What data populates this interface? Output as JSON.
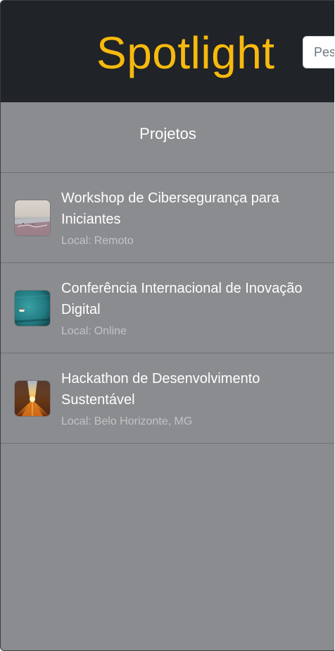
{
  "header": {
    "brand": "Spotlight",
    "search_placeholder": "Pesquisar"
  },
  "section": {
    "title": "Projetos"
  },
  "projects": [
    {
      "title": "Workshop de Cibersegurança para Iniciantes",
      "location_prefix": "Local:",
      "location": "Remoto",
      "thumbnail": "beach-photo"
    },
    {
      "title": "Conferência Internacional de Inovação Digital",
      "location_prefix": "Local:",
      "location": "Online",
      "thumbnail": "sea-boat-photo"
    },
    {
      "title": "Hackathon de Desenvolvimento Sustentável",
      "location_prefix": "Local:",
      "location": "Belo Horizonte, MG",
      "thumbnail": "sunset-street-photo"
    }
  ],
  "colors": {
    "header_bg": "#202327",
    "brand": "#f7b90e",
    "content_bg": "#8b8c8f",
    "divider": "#6f7175",
    "title_text": "#ffffff",
    "meta_text": "#c1c3c6"
  }
}
